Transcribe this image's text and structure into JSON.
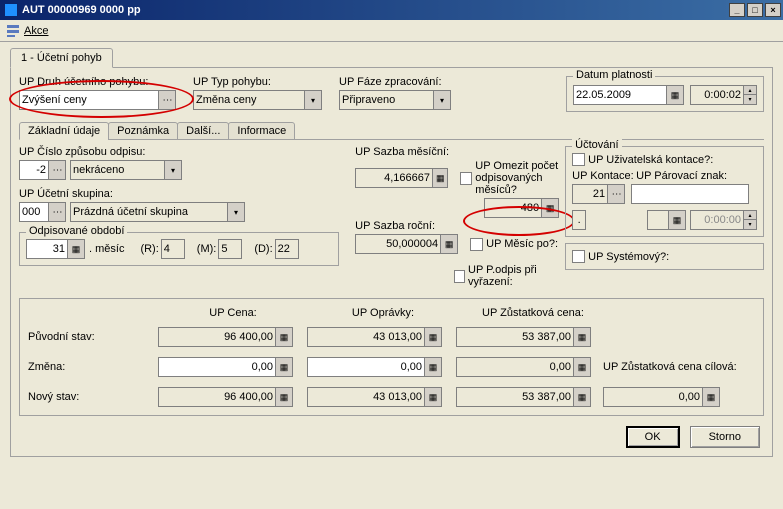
{
  "window": {
    "title": "AUT 00000969 0000 pp",
    "minimize": "_",
    "maximize": "□",
    "close": "×"
  },
  "menu": {
    "akce": "Akce"
  },
  "tab_main": "1 - Účetní pohyb",
  "top": {
    "druh_label": "UP Druh účetního pohybu:",
    "druh_value": "Zvýšení ceny",
    "typ_label": "UP Typ pohybu:",
    "typ_value": "Změna ceny",
    "faze_label": "UP Fáze zpracování:",
    "faze_value": "Připraveno",
    "datum_group": "Datum platnosti",
    "datum_value": "22.05.2009",
    "time_value": "0:00:02"
  },
  "inner_tabs": [
    "Základní údaje",
    "Poznámka",
    "Další...",
    "Informace"
  ],
  "left": {
    "cislo_label": "UP Číslo způsobu odpisu:",
    "cislo_code": "-2",
    "cislo_text": "nekráceno",
    "ucet_label": "UP Účetní skupina:",
    "ucet_code": "000",
    "ucet_text": "Prázdná účetní skupina",
    "odpis_group": "Odpisované období",
    "odpis_mesic": "31",
    "odpis_mesic_lbl": ". měsíc",
    "r_lbl": "(R):",
    "r_val": "4",
    "m_lbl": "(M):",
    "m_val": "5",
    "d_lbl": "(D):",
    "d_val": "22"
  },
  "mid": {
    "sazba_mes_lbl": "UP Sazba měsíční:",
    "sazba_mes_val": "4,166667",
    "sazba_roc_lbl": "UP Sazba roční:",
    "sazba_roc_val": "50,000004",
    "omezit_lbl": "UP Omezit počet odpisovaných měsíců?",
    "omezit_val": "480",
    "mesic_po_lbl": "UP Měsíc po?:",
    "podpis_lbl": "UP P.odpis při vyřazení:"
  },
  "right_group": "Účtování",
  "right": {
    "uziv_lbl": "UP Uživatelská kontace?:",
    "kontace_lbl": "UP Kontace:",
    "kontace_val": "21",
    "parov_lbl": "UP Párovací znak:",
    "dot_val": ".",
    "time2": "0:00:00",
    "systemovy_lbl": "UP Systémový?:"
  },
  "table": {
    "hdr_cena": "UP Cena:",
    "hdr_opravky": "UP Oprávky:",
    "hdr_zust": "UP Zůstatková cena:",
    "rows": {
      "puvodni": {
        "label": "Původní stav:",
        "cena": "96 400,00",
        "opravky": "43 013,00",
        "zust": "53 387,00"
      },
      "zmena": {
        "label": "Změna:",
        "cena": "0,00",
        "opravky": "0,00",
        "zust": "0,00"
      },
      "novy": {
        "label": "Nový stav:",
        "cena": "96 400,00",
        "opravky": "43 013,00",
        "zust": "53 387,00"
      }
    },
    "zust_cilova_lbl": "UP Zůstatková cena cílová:",
    "zust_cilova_val": "0,00"
  },
  "buttons": {
    "ok": "OK",
    "storno": "Storno"
  }
}
